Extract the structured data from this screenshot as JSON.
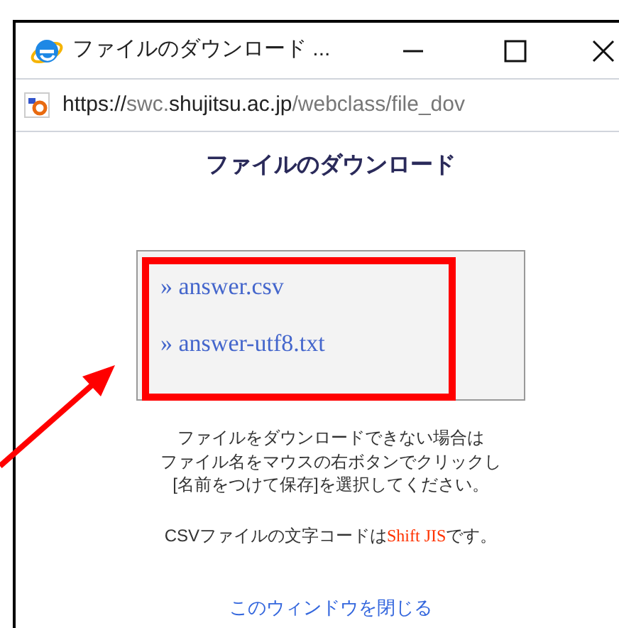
{
  "window": {
    "title": "ファイルのダウンロード ..."
  },
  "address_bar": {
    "url_parts": [
      {
        "text": "https://",
        "emphasized": true
      },
      {
        "text": "swc.",
        "emphasized": false
      },
      {
        "text": "shujitsu.ac.jp",
        "emphasized": true
      },
      {
        "text": "/webclass/file_dov",
        "emphasized": false
      }
    ]
  },
  "page": {
    "heading": "ファイルのダウンロード",
    "files": [
      {
        "label": "» answer.csv"
      },
      {
        "label": "» answer-utf8.txt"
      }
    ],
    "instructions": [
      "ファイルをダウンロードできない場合は",
      "ファイル名をマウスの右ボタンでクリックし",
      "[名前をつけて保存]を選択してください。"
    ],
    "encoding_note": [
      {
        "text": "CSVファイルの文字コードは",
        "kind": "plain"
      },
      {
        "text": "Shift JIS",
        "kind": "highlight"
      },
      {
        "text": "です。",
        "kind": "plain"
      }
    ],
    "close_link": "このウィンドウを閉じる"
  }
}
